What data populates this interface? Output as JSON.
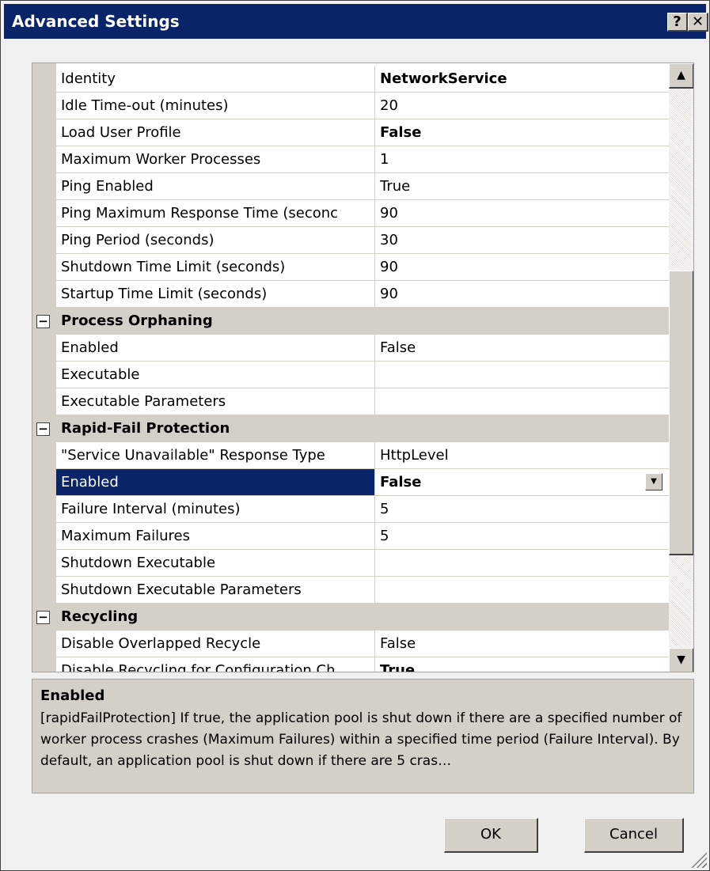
{
  "window": {
    "title": "Advanced Settings",
    "help_glyph": "?",
    "close_glyph": "✕"
  },
  "grid_rows": [
    {
      "type": "prop",
      "name": "Identity",
      "value": "NetworkService",
      "bold": true
    },
    {
      "type": "prop",
      "name": "Idle Time-out (minutes)",
      "value": "20"
    },
    {
      "type": "prop",
      "name": "Load User Profile",
      "value": "False",
      "bold": true
    },
    {
      "type": "prop",
      "name": "Maximum Worker Processes",
      "value": "1"
    },
    {
      "type": "prop",
      "name": "Ping Enabled",
      "value": "True"
    },
    {
      "type": "prop",
      "name": "Ping Maximum Response Time (seconc",
      "value": "90"
    },
    {
      "type": "prop",
      "name": "Ping Period (seconds)",
      "value": "30"
    },
    {
      "type": "prop",
      "name": "Shutdown Time Limit (seconds)",
      "value": "90"
    },
    {
      "type": "prop",
      "name": "Startup Time Limit (seconds)",
      "value": "90"
    },
    {
      "type": "category",
      "name": "Process Orphaning",
      "toggle": "−"
    },
    {
      "type": "prop",
      "name": "Enabled",
      "value": "False"
    },
    {
      "type": "prop",
      "name": "Executable",
      "value": ""
    },
    {
      "type": "prop",
      "name": "Executable Parameters",
      "value": ""
    },
    {
      "type": "category",
      "name": "Rapid-Fail Protection",
      "toggle": "−"
    },
    {
      "type": "prop",
      "name": "\"Service Unavailable\" Response Type",
      "value": "HttpLevel"
    },
    {
      "type": "prop",
      "name": "Enabled",
      "value": "False",
      "bold": true,
      "selected": true,
      "dropdown": "▼"
    },
    {
      "type": "prop",
      "name": "Failure Interval (minutes)",
      "value": "5"
    },
    {
      "type": "prop",
      "name": "Maximum Failures",
      "value": "5"
    },
    {
      "type": "prop",
      "name": "Shutdown Executable",
      "value": ""
    },
    {
      "type": "prop",
      "name": "Shutdown Executable Parameters",
      "value": ""
    },
    {
      "type": "category",
      "name": "Recycling",
      "toggle": "−"
    },
    {
      "type": "prop",
      "name": "Disable Overlapped Recycle",
      "value": "False"
    },
    {
      "type": "prop",
      "name": "Disable Recycling for Configuration Ch",
      "value": "True",
      "bold": true
    }
  ],
  "scrollbar": {
    "up_glyph": "▲",
    "down_glyph": "▼"
  },
  "description": {
    "title": "Enabled",
    "text": "[rapidFailProtection] If true, the application pool is shut down if there are a specified number of worker process crashes (Maximum Failures) within a specified time period (Failure Interval).  By default, an application pool is shut down if there are 5 cras…"
  },
  "buttons": {
    "ok": "OK",
    "cancel": "Cancel"
  }
}
